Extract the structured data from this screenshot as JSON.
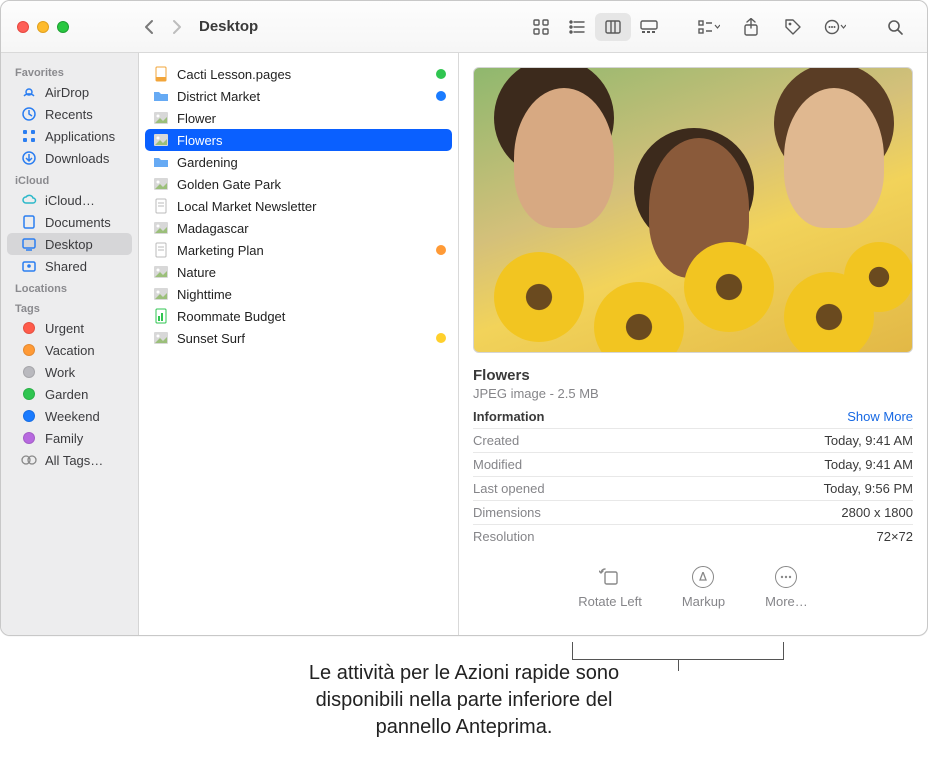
{
  "window": {
    "title": "Desktop"
  },
  "sidebar": {
    "sections": [
      {
        "header": "Favorites",
        "items": [
          {
            "label": "AirDrop",
            "icon": "airdrop"
          },
          {
            "label": "Recents",
            "icon": "clock"
          },
          {
            "label": "Applications",
            "icon": "apps"
          },
          {
            "label": "Downloads",
            "icon": "download"
          }
        ]
      },
      {
        "header": "iCloud",
        "items": [
          {
            "label": "iCloud…",
            "icon": "cloud"
          },
          {
            "label": "Documents",
            "icon": "doc"
          },
          {
            "label": "Desktop",
            "icon": "desktop",
            "selected": true
          },
          {
            "label": "Shared",
            "icon": "shared"
          }
        ]
      },
      {
        "header": "Locations",
        "items": []
      },
      {
        "header": "Tags",
        "items": [
          {
            "label": "Urgent",
            "color": "#ff5b4a"
          },
          {
            "label": "Vacation",
            "color": "#ff9a36"
          },
          {
            "label": "Work",
            "color": "#b9b9be"
          },
          {
            "label": "Garden",
            "color": "#2fc550"
          },
          {
            "label": "Weekend",
            "color": "#1a7bff"
          },
          {
            "label": "Family",
            "color": "#b769df"
          },
          {
            "label": "All Tags…",
            "icon": "alltags"
          }
        ]
      }
    ]
  },
  "files": [
    {
      "name": "Cacti Lesson.pages",
      "kind": "pages",
      "tag": "#2fc550"
    },
    {
      "name": "District Market",
      "kind": "folder",
      "tag": "#1a7bff"
    },
    {
      "name": "Flower",
      "kind": "image"
    },
    {
      "name": "Flowers",
      "kind": "image",
      "selected": true
    },
    {
      "name": "Gardening",
      "kind": "folder"
    },
    {
      "name": "Golden Gate Park",
      "kind": "image"
    },
    {
      "name": "Local Market Newsletter",
      "kind": "doc"
    },
    {
      "name": "Madagascar",
      "kind": "image"
    },
    {
      "name": "Marketing Plan",
      "kind": "doc",
      "tag": "#ff9a36"
    },
    {
      "name": "Nature",
      "kind": "image"
    },
    {
      "name": "Nighttime",
      "kind": "image"
    },
    {
      "name": "Roommate Budget",
      "kind": "numbers"
    },
    {
      "name": "Sunset Surf",
      "kind": "image",
      "tag": "#ffd02c"
    }
  ],
  "preview": {
    "title": "Flowers",
    "subtitle": "JPEG image - 2.5 MB",
    "info_header": "Information",
    "show_more": "Show More",
    "rows": [
      {
        "label": "Created",
        "value": "Today, 9:41 AM"
      },
      {
        "label": "Modified",
        "value": "Today, 9:41 AM"
      },
      {
        "label": "Last opened",
        "value": "Today, 9:56 PM"
      },
      {
        "label": "Dimensions",
        "value": "2800 x 1800"
      },
      {
        "label": "Resolution",
        "value": "72×72"
      }
    ],
    "actions": {
      "rotate": "Rotate Left",
      "markup": "Markup",
      "more": "More…"
    }
  },
  "callout": {
    "line1": "Le attività per le Azioni rapide sono",
    "line2": "disponibili nella parte inferiore del",
    "line3": "pannello Anteprima."
  },
  "colors": {
    "accent": "#0a60ff"
  }
}
